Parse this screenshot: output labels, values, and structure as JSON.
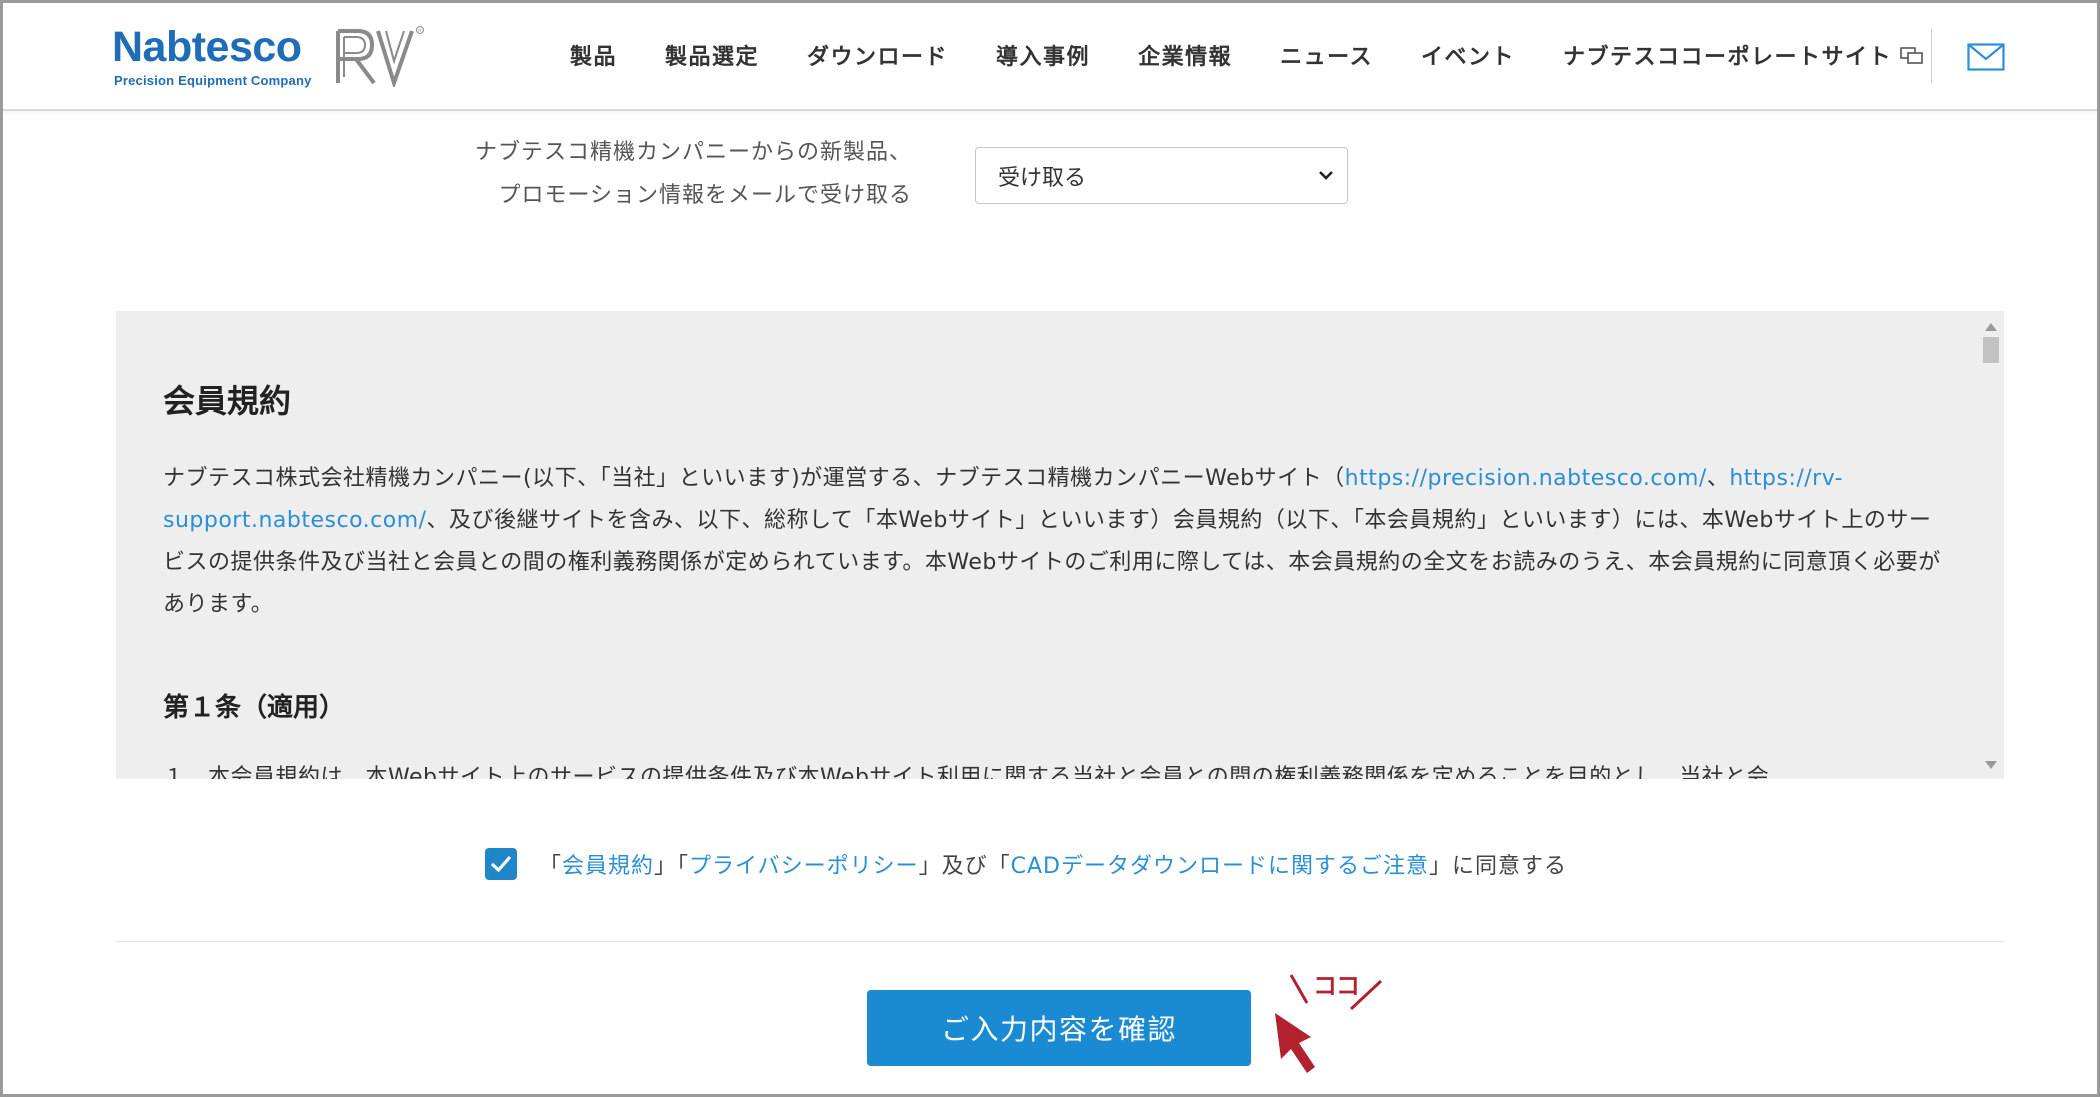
{
  "brand": {
    "name": "Nabtesco",
    "tagline": "Precision Equipment Company",
    "product_mark": "RV",
    "color": "#1f6db8"
  },
  "nav": {
    "items": [
      "製品",
      "製品選定",
      "ダウンロード",
      "導入事例",
      "企業情報",
      "ニュース",
      "イベント"
    ],
    "external": "ナブテスココーポレートサイト"
  },
  "newsletter": {
    "label_line1": "ナブテスコ精機カンパニーからの新製品、",
    "label_line2": "プロモーション情報をメールで受け取る",
    "selected": "受け取る"
  },
  "terms": {
    "title": "会員規約",
    "p1_a": "ナブテスコ株式会社精機カンパニー(以下、「当社」といいます)が運営する、ナブテスコ精機カンパニーWebサイト（",
    "p1_link1": "https://precision.nabtesco.com/",
    "p1_b": "、",
    "p1_link2": "https://rv-support.nabtesco.com/",
    "p1_c": "、及び後継サイトを含み、以下、総称して「本Webサイト」といいます）会員規約（以下、「本会員規約」といいます）には、本Webサイト上のサービスの提供条件及び当社と会員との間の権利義務関係が定められています。本Webサイトのご利用に際しては、本会員規約の全文をお読みのうえ、本会員規約に同意頂く必要があります。",
    "article1_title": "第１条（適用）",
    "article1_cut": "１．本会員規約は、本Webサイト上のサービスの提供条件及び本Webサイト利用に関する当社と会員との間の権利義務関係を定めることを目的とし、当社と会"
  },
  "agreement": {
    "q1": "「",
    "link1": "会員規約",
    "q2": "」「",
    "link2": "プライバシーポリシー",
    "q3": "」及び「",
    "link3": "CADデータダウンロードに関するご注意",
    "q4": "」に同意する",
    "checked": true
  },
  "confirm_button": "ご入力内容を確認",
  "annotation": {
    "text": "ココ",
    "color": "#b3212f"
  },
  "colors": {
    "accent": "#1a8ad3",
    "link": "#2a8fd6"
  }
}
